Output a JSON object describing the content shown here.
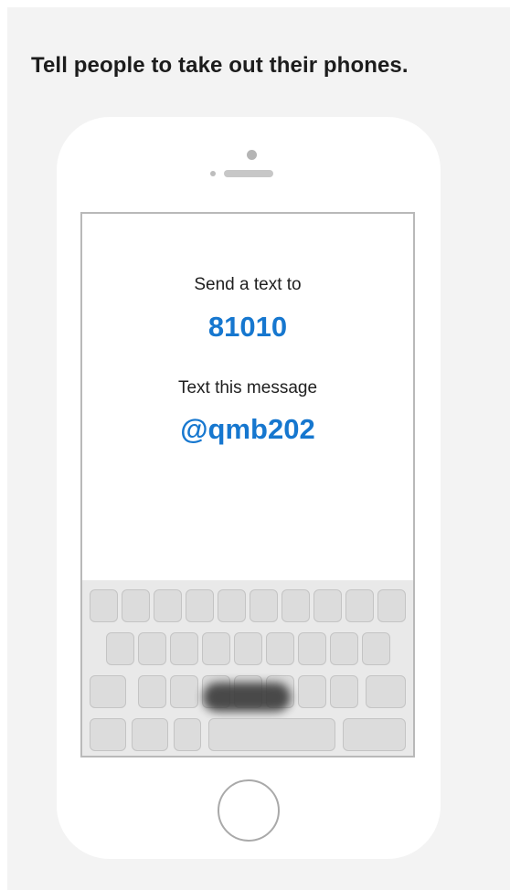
{
  "headline": "Tell people to take out their phones.",
  "phone_screen": {
    "send_label": "Send a text to",
    "number": "81010",
    "message_label": "Text this message",
    "message_code": "@qmb202"
  },
  "icons": {
    "camera": "front-camera-icon",
    "speaker": "speaker-grille-icon",
    "home": "home-button-icon",
    "keyboard": "on-screen-keyboard"
  },
  "colors": {
    "accent": "#1677cf",
    "background": "#f3f3f3",
    "phone_body": "#ffffff",
    "text": "#1c1c1c"
  }
}
